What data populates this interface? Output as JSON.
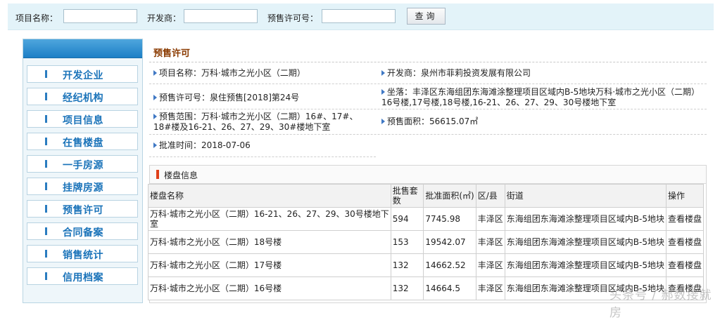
{
  "search": {
    "project_label": "项目名称：",
    "developer_label": "开发商：",
    "permit_label": "预售许可号：",
    "project_value": "",
    "developer_value": "",
    "permit_value": "",
    "button_label": "查询"
  },
  "sidebar": {
    "items": [
      {
        "label": "开发企业"
      },
      {
        "label": "经纪机构"
      },
      {
        "label": "项目信息"
      },
      {
        "label": "在售楼盘"
      },
      {
        "label": "一手房源"
      },
      {
        "label": "挂牌房源"
      },
      {
        "label": "预售许可"
      },
      {
        "label": "合同备案"
      },
      {
        "label": "销售统计"
      },
      {
        "label": "信用档案"
      }
    ]
  },
  "main": {
    "title": "预售许可",
    "project_name": "项目名称：万科·城市之光小区（二期）",
    "developer": "开发商：泉州市菲莉投资发展有限公司",
    "permit_no": "预售许可号：泉住预售[2018]第24号",
    "location_line1": "坐落：丰泽区东海组团东海滩涂整理项目区域内B-5地块万科·城市之光小区（二期）",
    "location_line2": "16号楼,17号楼,18号楼,16-21、26、27、29、30号楼地下室",
    "scope_line1": "预售范围：万科·城市之光小区（二期）16#、17#、",
    "scope_line2": "18#楼及16-21、26、27、29、30#楼地下室",
    "area": "预售面积：56615.07㎡",
    "approval_date": "批准时间：2018-07-06"
  },
  "buildings": {
    "title": "楼盘信息",
    "headers": {
      "name": "楼盘名称",
      "units_line1": "批售套",
      "units_line2": "数",
      "area": "批准面积(㎡)",
      "district": "区/县",
      "street": "街道",
      "action": "操作"
    },
    "rows": [
      {
        "name_line1": "万科·城市之光小区（二期）16-21、26、27、29、30号楼地下",
        "name_line2": "室",
        "units": "594",
        "area": "7745.98",
        "district": "丰泽区",
        "street": "东海组团东海滩涂整理项目区域内B-5地块",
        "action": "查看楼盘"
      },
      {
        "name_line1": "万科·城市之光小区（二期）18号楼",
        "name_line2": "",
        "units": "153",
        "area": "19542.07",
        "district": "丰泽区",
        "street": "东海组团东海滩涂整理项目区域内B-5地块",
        "action": "查看楼盘"
      },
      {
        "name_line1": "万科·城市之光小区（二期）17号楼",
        "name_line2": "",
        "units": "132",
        "area": "14662.52",
        "district": "丰泽区",
        "street": "东海组团东海滩涂整理项目区域内B-5地块",
        "action": "查看楼盘"
      },
      {
        "name_line1": "万科·城市之光小区（二期）16号楼",
        "name_line2": "",
        "units": "132",
        "area": "14664.5",
        "district": "丰泽区",
        "street": "东海组团东海滩涂整理项目区域内B-5地块",
        "action": "查看楼盘"
      }
    ]
  },
  "watermark": "头条号 / 郝数接就房",
  "chart_data": {
    "type": "table",
    "columns": [
      "楼盘名称",
      "批售套数",
      "批准面积(㎡)",
      "区/县",
      "街道",
      "操作"
    ],
    "rows": [
      [
        "万科·城市之光小区（二期）16-21、26、27、29、30号楼地下室",
        594,
        7745.98,
        "丰泽区",
        "东海组团东海滩涂整理项目区域内B-5地块",
        "查看楼盘"
      ],
      [
        "万科·城市之光小区（二期）18号楼",
        153,
        19542.07,
        "丰泽区",
        "东海组团东海滩涂整理项目区域内B-5地块",
        "查看楼盘"
      ],
      [
        "万科·城市之光小区（二期）17号楼",
        132,
        14662.52,
        "丰泽区",
        "东海组团东海滩涂整理项目区域内B-5地块",
        "查看楼盘"
      ],
      [
        "万科·城市之光小区（二期）16号楼",
        132,
        14664.5,
        "丰泽区",
        "东海组团东海滩涂整理项目区域内B-5地块",
        "查看楼盘"
      ]
    ]
  }
}
